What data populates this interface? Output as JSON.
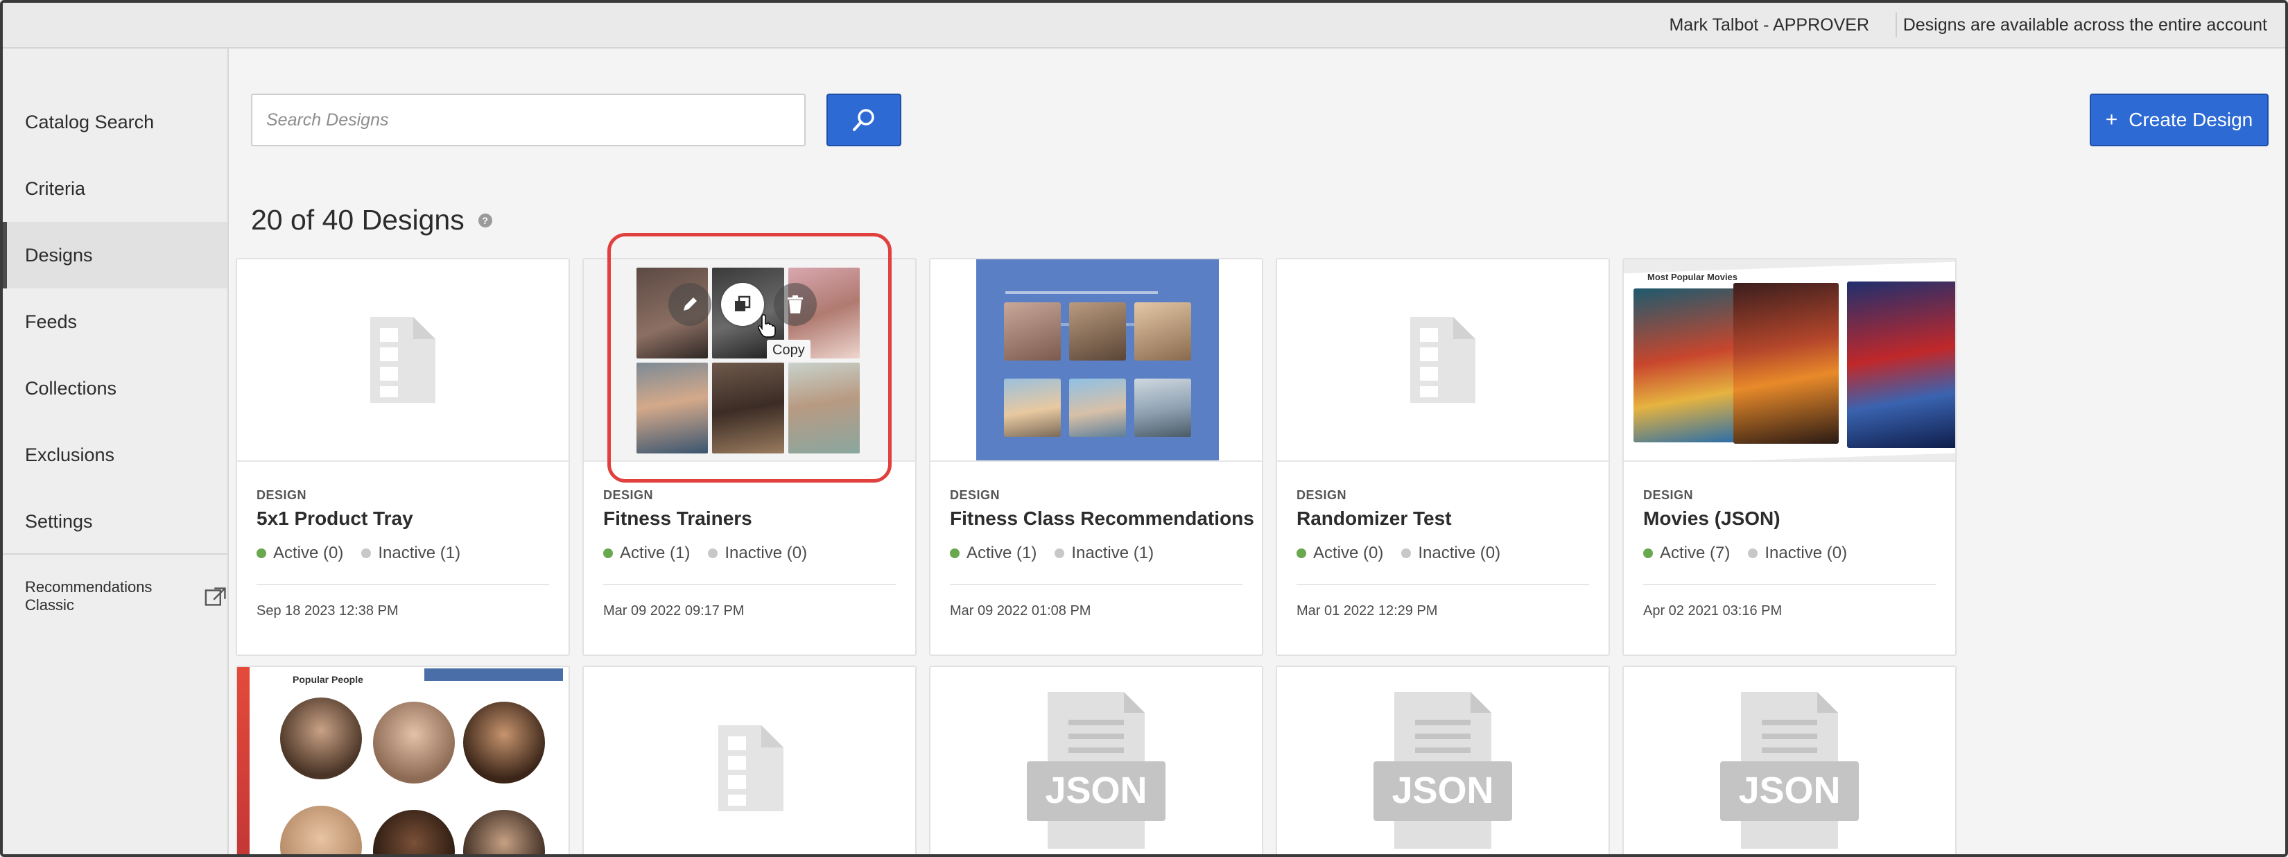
{
  "topbar": {
    "user": "Mark Talbot - APPROVER",
    "notice": "Designs are available across the entire account"
  },
  "sidebar": {
    "items": [
      {
        "label": "Catalog Search"
      },
      {
        "label": "Criteria"
      },
      {
        "label": "Designs",
        "active": true
      },
      {
        "label": "Feeds"
      },
      {
        "label": "Collections"
      },
      {
        "label": "Exclusions"
      },
      {
        "label": "Settings"
      }
    ],
    "classic_link": "Recommendations Classic"
  },
  "toolbar": {
    "search_placeholder": "Search Designs",
    "search_value": "",
    "create_label": "Create Design",
    "create_icon": "+"
  },
  "results": {
    "title": "20 of 40 Designs",
    "help_icon": "?"
  },
  "cards": [
    {
      "label": "DESIGN",
      "name": "5x1 Product Tray",
      "active": "Active (0)",
      "inactive": "Inactive (1)",
      "date": "Sep 18 2023 12:38 PM",
      "thumb": "document-icon"
    },
    {
      "label": "DESIGN",
      "name": "Fitness Trainers",
      "active": "Active (1)",
      "inactive": "Inactive (0)",
      "date": "Mar 09 2022 09:17 PM",
      "thumb": "photo-grid",
      "hover_actions": [
        "edit-icon",
        "copy-icon",
        "delete-icon"
      ],
      "tooltip": "Copy"
    },
    {
      "label": "DESIGN",
      "name": "Fitness Class Recommendations",
      "active": "Active (1)",
      "inactive": "Inactive (1)",
      "date": "Mar 09 2022 01:08 PM",
      "thumb": "fitness-class-board"
    },
    {
      "label": "DESIGN",
      "name": "Randomizer Test",
      "active": "Active (0)",
      "inactive": "Inactive (0)",
      "date": "Mar 01 2022 12:29 PM",
      "thumb": "document-icon"
    },
    {
      "label": "DESIGN",
      "name": "Movies (JSON)",
      "active": "Active (7)",
      "inactive": "Inactive (0)",
      "date": "Apr 02 2021 03:16 PM",
      "thumb": "movie-posters",
      "thumb_heading": "Most Popular Movies"
    }
  ],
  "row2": [
    {
      "thumb": "popular-people",
      "heading": "Popular People"
    },
    {
      "thumb": "document-icon"
    },
    {
      "thumb": "json-file-icon",
      "text": "JSON"
    },
    {
      "thumb": "json-file-icon",
      "text": "JSON"
    },
    {
      "thumb": "json-file-icon",
      "text": "JSON"
    }
  ],
  "colors": {
    "accent": "#2d6ad3",
    "active_dot": "#6aa84f",
    "inactive_dot": "#c8c8c8",
    "highlight": "#e0413e"
  }
}
